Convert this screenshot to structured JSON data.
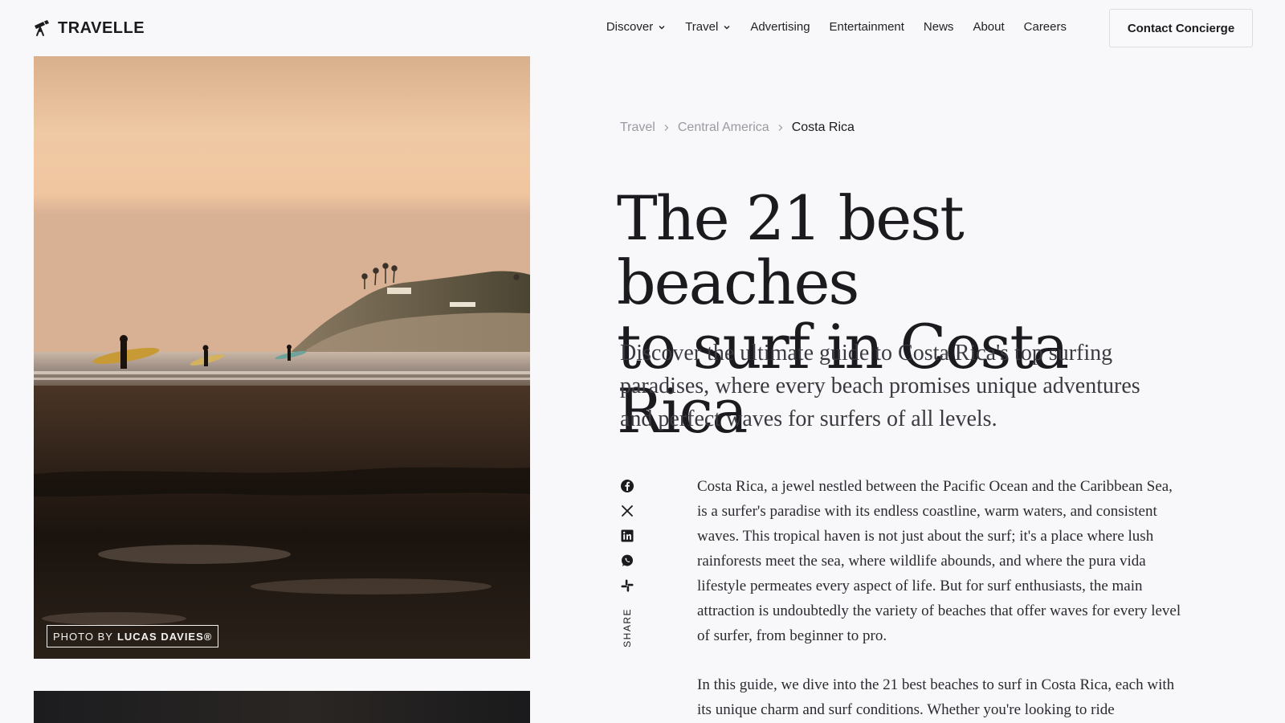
{
  "brand": {
    "name": "TRAVELLE",
    "logo_icon": "telescope-icon"
  },
  "nav": {
    "items": [
      {
        "label": "Discover",
        "dropdown": true
      },
      {
        "label": "Travel",
        "dropdown": true
      },
      {
        "label": "Advertising",
        "dropdown": false
      },
      {
        "label": "Entertainment",
        "dropdown": false
      },
      {
        "label": "News",
        "dropdown": false
      },
      {
        "label": "About",
        "dropdown": false
      },
      {
        "label": "Careers",
        "dropdown": false
      }
    ],
    "cta_label": "Contact Concierge"
  },
  "hero": {
    "credit_prefix": "PHOTO BY",
    "credit_name": "LUCAS DAVIES®"
  },
  "article": {
    "breadcrumb": [
      "Travel",
      "Central America",
      "Costa Rica"
    ],
    "title_line1": "The 21 best beaches",
    "title_line2": "to surf in Costa Rica",
    "subtitle": "Discover the ultimate guide to Costa Rica's top surfing paradises, where every beach promises unique adventures and perfect waves for surfers of all levels.",
    "paragraphs": [
      "Costa Rica, a jewel nestled between the Pacific Ocean and the Caribbean Sea, is a surfer's paradise with its endless coastline, warm waters, and consistent waves. This tropical haven is not just about the surf; it's a place where lush rainforests meet the sea, where wildlife abounds, and where the pura vida lifestyle permeates every aspect of life. But for surf enthusiasts, the main attraction is undoubtedly the variety of beaches that offer waves for every level of surfer, from beginner to pro.",
      "In this guide, we dive into the 21 best beaches to surf in Costa Rica, each with its unique charm and surf conditions. Whether you're looking to ride"
    ]
  },
  "share": {
    "label": "SHARE",
    "icons": [
      "facebook-icon",
      "x-icon",
      "linkedin-icon",
      "whatsapp-icon",
      "slack-icon"
    ]
  },
  "colors": {
    "background": "#f8f8fa",
    "text": "#1b1b1f",
    "muted": "#9a9aa2"
  }
}
